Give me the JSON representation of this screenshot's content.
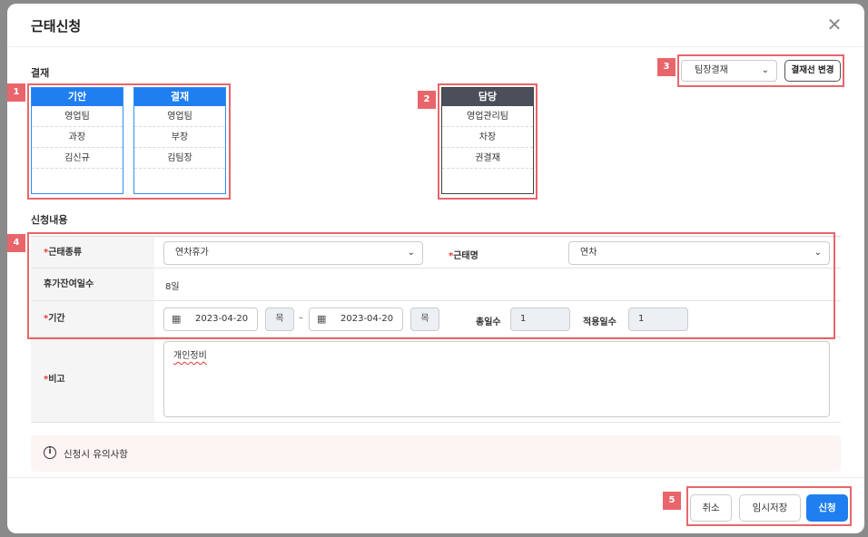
{
  "modal": {
    "title": "근태신청",
    "close_glyph": "✕"
  },
  "approval": {
    "section_label": "결재",
    "drafter": {
      "head": "기안",
      "cells": [
        "영업팀",
        "과장",
        "김신규",
        ""
      ]
    },
    "approver": {
      "head": "결재",
      "cells": [
        "영업팀",
        "부장",
        "김팀장",
        ""
      ]
    },
    "handler": {
      "head": "담당",
      "cells": [
        "영업관리팀",
        "차장",
        "권결재",
        ""
      ]
    },
    "line_select": "팀장결재",
    "change_button": "결재선 변경"
  },
  "markers": [
    "1",
    "2",
    "3",
    "4",
    "5"
  ],
  "request": {
    "section_label": "신청내용",
    "attendance_type_label": "근태종류",
    "attendance_type_value": "연차휴가",
    "attendance_name_label": "근태명",
    "attendance_name_value": "연차",
    "remaining_label": "휴가잔여일수",
    "remaining_value": "8일",
    "period_label": "기간",
    "start_date": "2023-04-20",
    "start_day": "목",
    "date_separator": "–",
    "end_date": "2023-04-20",
    "end_day": "목",
    "total_days_label": "총일수",
    "total_days_value": "1",
    "applied_days_label": "적용일수",
    "applied_days_value": "1",
    "remark_label": "비고",
    "remark_value": "개인정비",
    "required_mark": "*"
  },
  "notice": {
    "icon_glyph": "i",
    "text": "신청시 유의사항"
  },
  "footer": {
    "cancel": "취소",
    "temp_save": "임시저장",
    "submit": "신청"
  },
  "colors": {
    "primary": "#1f7ff0",
    "marker": "#e8666b",
    "required": "#e53935"
  }
}
